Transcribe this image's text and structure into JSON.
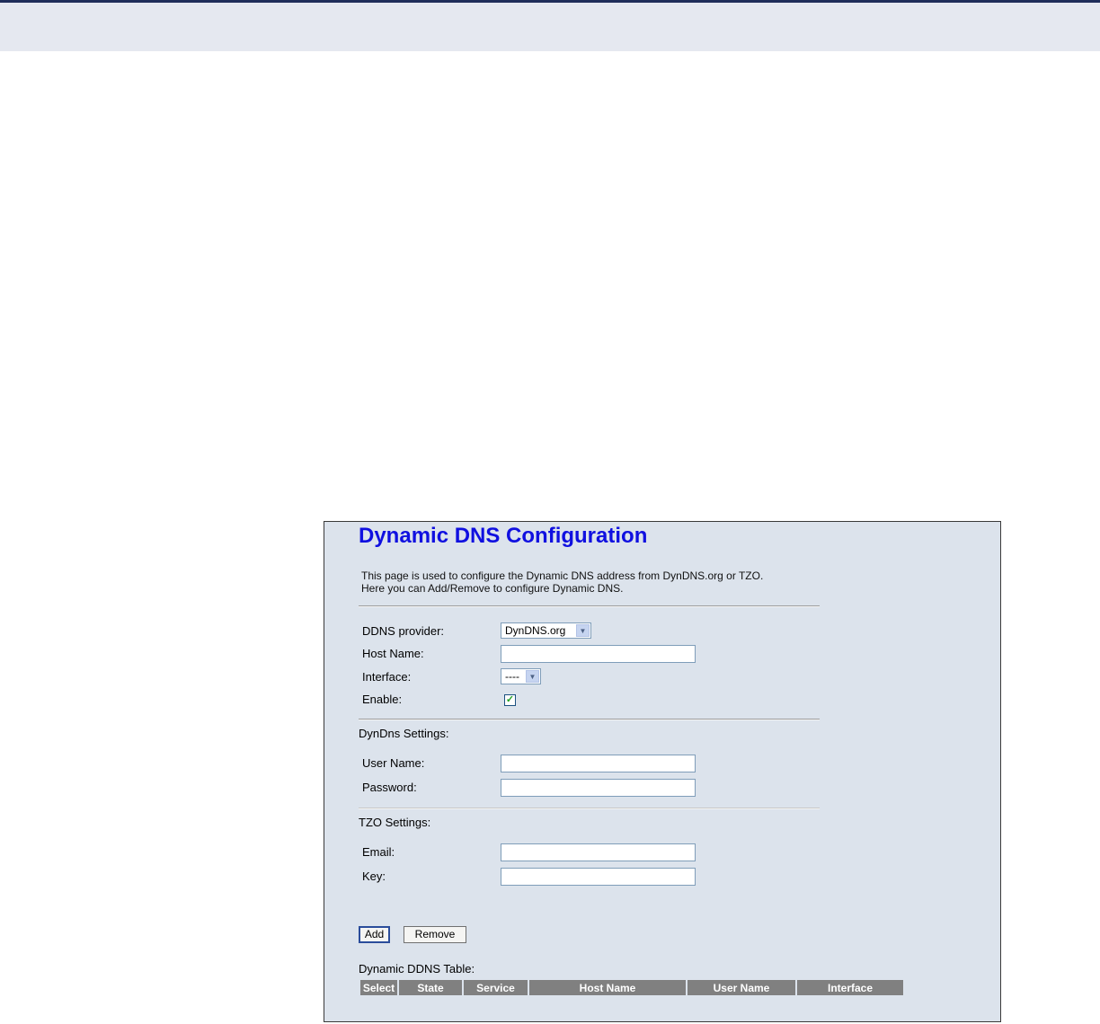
{
  "page": {
    "title": "Dynamic DNS Configuration",
    "description_line1": "This page is used to configure the Dynamic DNS address from DynDNS.org or TZO.",
    "description_line2": "Here you can Add/Remove to configure Dynamic DNS."
  },
  "form": {
    "provider_label": "DDNS provider:",
    "provider_value": "DynDNS.org",
    "hostname_label": "Host Name:",
    "hostname_value": "",
    "interface_label": "Interface:",
    "interface_value": "----",
    "enable_label": "Enable:",
    "enable_checked": true
  },
  "dyndns": {
    "section_label": "DynDns Settings:",
    "username_label": "User Name:",
    "username_value": "",
    "password_label": "Password:",
    "password_value": ""
  },
  "tzo": {
    "section_label": "TZO Settings:",
    "email_label": "Email:",
    "email_value": "",
    "key_label": "Key:",
    "key_value": ""
  },
  "buttons": {
    "add": "Add",
    "remove": "Remove"
  },
  "table": {
    "title": "Dynamic DDNS Table:",
    "headers": [
      "Select",
      "State",
      "Service",
      "Host Name",
      "User Name",
      "Interface"
    ]
  },
  "colors": {
    "title": "#1010e0",
    "panel_bg": "#dce3ec",
    "header_bg": "#808080",
    "top_band": "#e5e8f0"
  }
}
